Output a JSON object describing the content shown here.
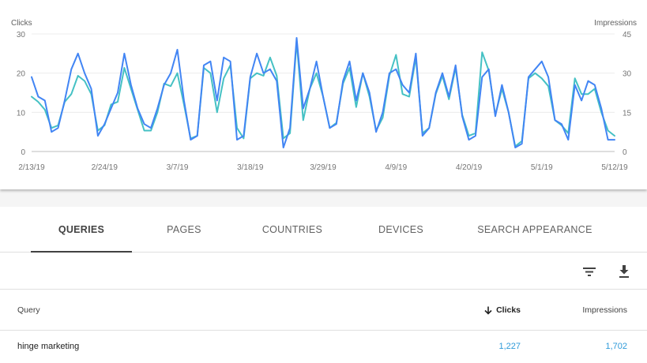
{
  "chart": {
    "left_axis_title": "Clicks",
    "right_axis_title": "Impressions",
    "left_ticks": [
      "30",
      "20",
      "10",
      "0"
    ],
    "right_ticks": [
      "45",
      "30",
      "15",
      "0"
    ],
    "x_ticks": [
      "2/13/19",
      "2/24/19",
      "3/7/19",
      "3/18/19",
      "3/29/19",
      "4/9/19",
      "4/20/19",
      "5/1/19",
      "5/12/19"
    ]
  },
  "chart_data": {
    "type": "line",
    "x_start": "2/13/19",
    "x_end": "5/13/19",
    "y_left": {
      "label": "Clicks",
      "lim": [
        0,
        30
      ]
    },
    "y_right": {
      "label": "Impressions",
      "lim": [
        0,
        45
      ]
    },
    "grid": true,
    "series": [
      {
        "name": "Clicks",
        "axis": "left",
        "color": "#4285f4",
        "values": [
          19,
          14,
          13,
          5,
          6,
          13,
          21,
          25,
          20,
          16,
          4,
          7,
          11,
          15,
          25,
          17,
          11,
          7,
          6,
          11,
          17,
          20,
          26,
          13,
          3,
          4,
          22,
          23,
          13,
          24,
          23,
          3,
          4,
          19,
          25,
          20,
          21,
          18,
          1,
          6,
          29,
          11,
          16,
          23,
          14,
          6,
          7,
          18,
          23,
          13,
          20,
          15,
          5,
          10,
          20,
          21,
          17,
          15,
          25,
          4,
          6,
          15,
          20,
          14,
          22,
          9,
          3,
          4,
          19,
          21,
          9,
          17,
          10,
          1,
          2,
          19,
          21,
          23,
          19,
          8,
          7,
          3,
          17,
          13,
          18,
          17,
          11,
          3,
          3
        ]
      },
      {
        "name": "Impressions",
        "axis": "right",
        "color": "#45c1c4",
        "values": [
          21,
          19,
          16,
          9,
          10,
          19,
          22,
          29,
          27,
          22,
          8,
          10,
          18,
          19,
          32,
          24,
          16,
          8,
          8,
          15,
          26,
          25,
          30,
          18,
          5,
          6,
          32,
          30,
          15,
          28,
          33,
          9,
          5,
          28,
          30,
          29,
          36,
          29,
          5,
          7,
          42,
          12,
          24,
          30,
          21,
          9,
          11,
          26,
          32,
          17,
          30,
          21,
          8,
          13,
          29,
          37,
          22,
          21,
          36,
          7,
          9,
          22,
          29,
          20,
          32,
          14,
          6,
          7,
          38,
          31,
          14,
          24,
          15,
          2,
          4,
          28,
          30,
          28,
          25,
          12,
          10,
          7,
          28,
          22,
          22,
          24,
          15,
          8,
          6
        ]
      }
    ]
  },
  "tabs": [
    "QUERIES",
    "PAGES",
    "COUNTRIES",
    "DEVICES",
    "SEARCH APPEARANCE"
  ],
  "table": {
    "col_query": "Query",
    "col_clicks": "Clicks",
    "col_impressions": "Impressions",
    "rows": [
      {
        "query": "hinge marketing",
        "clicks": "1,227",
        "impressions": "1,702"
      }
    ]
  },
  "icons": {
    "filter": "filter-icon",
    "download": "download-icon",
    "sort": "arrow-down-icon"
  },
  "colors": {
    "clicks": "#4285f4",
    "impressions": "#45c1c4",
    "numbers": "#2e9ad9"
  }
}
